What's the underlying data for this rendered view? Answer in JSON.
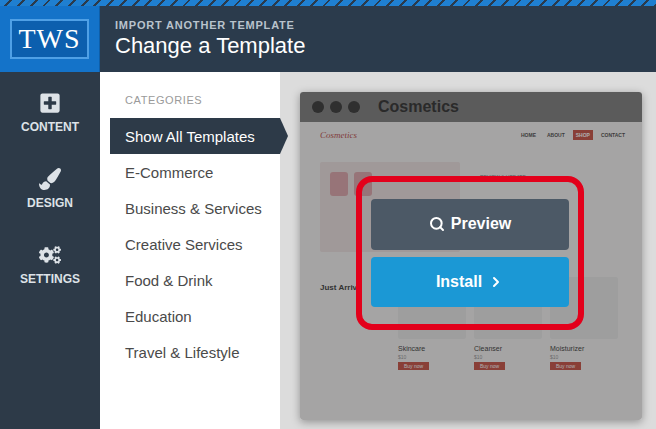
{
  "header": {
    "logo": "TWS",
    "subtitle": "IMPORT ANOTHER TEMPLATE",
    "title": "Change a Template"
  },
  "nav": [
    {
      "label": "CONTENT",
      "kind": "content",
      "selected": false
    },
    {
      "label": "DESIGN",
      "kind": "design",
      "selected": false
    },
    {
      "label": "SETTINGS",
      "kind": "settings",
      "selected": false
    }
  ],
  "categories": {
    "heading": "CATEGORIES",
    "items": [
      {
        "label": "Show All Templates",
        "selected": true
      },
      {
        "label": "E-Commerce",
        "selected": false
      },
      {
        "label": "Business & Services",
        "selected": false
      },
      {
        "label": "Creative Services",
        "selected": false
      },
      {
        "label": "Food & Drink",
        "selected": false
      },
      {
        "label": "Education",
        "selected": false
      },
      {
        "label": "Travel & Lifestyle",
        "selected": false
      }
    ]
  },
  "template": {
    "name": "Cosmetics",
    "site": {
      "logo": "Cosmetics",
      "menu": [
        {
          "label": "HOME",
          "selected": false
        },
        {
          "label": "ABOUT",
          "selected": false
        },
        {
          "label": "SHOP",
          "selected": true
        },
        {
          "label": "CONTACT",
          "selected": false
        }
      ],
      "tagline": "REVIEW & UPDATE",
      "section": "Just Arriv",
      "products": [
        {
          "name": "Skincare",
          "price": "$10",
          "button": "Buy now"
        },
        {
          "name": "Cleanser",
          "price": "$10",
          "button": "Buy now"
        },
        {
          "name": "Moisturizer",
          "price": "$10",
          "button": "Buy now"
        }
      ]
    },
    "actions": [
      {
        "label": "Preview",
        "kind": "secondary"
      },
      {
        "label": "Install",
        "kind": "primary"
      }
    ]
  }
}
